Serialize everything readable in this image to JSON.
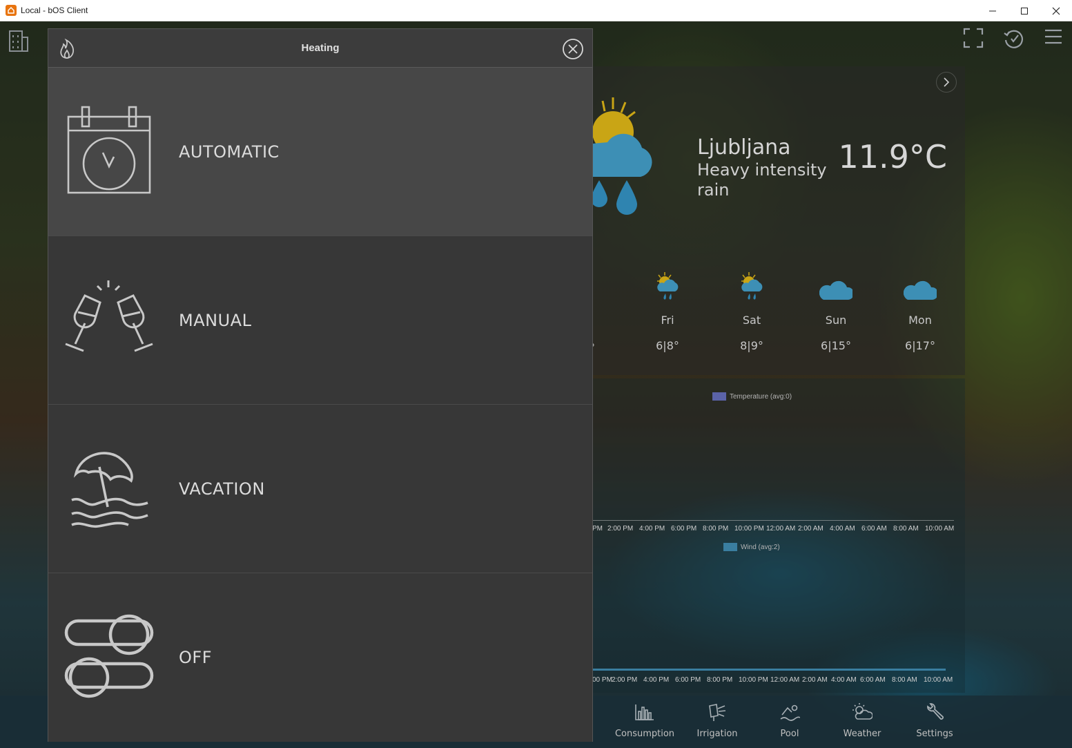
{
  "window": {
    "title": "Local - bOS Client",
    "controls": [
      "minimize",
      "maximize",
      "close"
    ]
  },
  "weather": {
    "city": "Ljubljana",
    "condition": "Heavy intensity rain",
    "temperature": "11.9°C",
    "partial_range": "°",
    "forecast": [
      {
        "day": "Fri",
        "range": "6|8°",
        "icon": "sun-rain-icon"
      },
      {
        "day": "Sat",
        "range": "8|9°",
        "icon": "sun-rain-icon"
      },
      {
        "day": "Sun",
        "range": "6|15°",
        "icon": "cloud-icon"
      },
      {
        "day": "Mon",
        "range": "6|17°",
        "icon": "cloud-icon"
      }
    ]
  },
  "charts": {
    "temperature_legend": "Temperature (avg:0)",
    "wind_legend": "Wind (avg:2)",
    "axis1_ticks": [
      "PM",
      "2:00 PM",
      "4:00 PM",
      "6:00 PM",
      "8:00 PM",
      "10:00 PM",
      "12:00 AM",
      "2:00 AM",
      "4:00 AM",
      "6:00 AM",
      "8:00 AM",
      "10:00 AM"
    ],
    "axis2_ticks": [
      "00 PM",
      "2:00 PM",
      "4:00 PM",
      "6:00 PM",
      "8:00 PM",
      "10:00 PM",
      "12:00 AM",
      "2:00 AM",
      "4:00 AM",
      "6:00 AM",
      "8:00 AM",
      "10:00 AM"
    ],
    "colors": {
      "temperature": "#5b63a8",
      "wind": "#3a7ea0"
    }
  },
  "bottom_nav": [
    {
      "label": "Consumption",
      "icon": "bar-chart-icon"
    },
    {
      "label": "Irrigation",
      "icon": "sprinkler-icon"
    },
    {
      "label": "Pool",
      "icon": "swimmer-icon"
    },
    {
      "label": "Weather",
      "icon": "sun-cloud-icon"
    },
    {
      "label": "Settings",
      "icon": "wrench-icon"
    }
  ],
  "modal": {
    "title": "Heating",
    "modes": [
      {
        "label": "AUTOMATIC",
        "icon": "calendar-clock-icon",
        "selected": true
      },
      {
        "label": "MANUAL",
        "icon": "toast-glasses-icon",
        "selected": false
      },
      {
        "label": "VACATION",
        "icon": "beach-umbrella-icon",
        "selected": false
      },
      {
        "label": "OFF",
        "icon": "toggle-off-icon",
        "selected": false
      }
    ]
  }
}
